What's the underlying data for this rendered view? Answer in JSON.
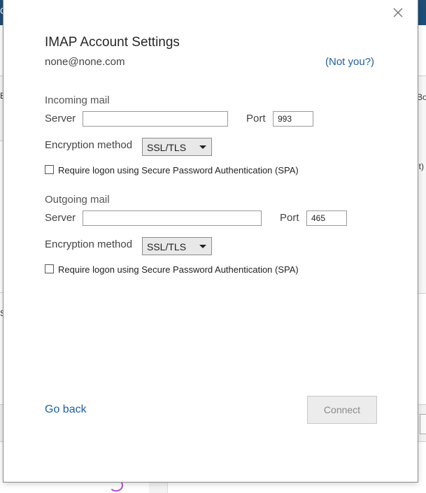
{
  "background": {
    "titlebar_letter": "O",
    "left_fragments": [
      "E",
      "S"
    ],
    "right_fragments": [
      "Bo",
      "lt)"
    ]
  },
  "dialog": {
    "title": "IMAP Account Settings",
    "email": "none@none.com",
    "not_you_link": "(Not you?)",
    "close_icon": "close-icon",
    "incoming": {
      "section_label": "Incoming mail",
      "server_label": "Server",
      "server_value": "",
      "port_label": "Port",
      "port_value": "993",
      "encryption_label": "Encryption method",
      "encryption_value": "SSL/TLS",
      "spa_label": "Require logon using Secure Password Authentication (SPA)",
      "spa_checked": false
    },
    "outgoing": {
      "section_label": "Outgoing mail",
      "server_label": "Server",
      "server_value": "",
      "port_label": "Port",
      "port_value": "465",
      "encryption_label": "Encryption method",
      "encryption_value": "SSL/TLS",
      "spa_label": "Require logon using Secure Password Authentication (SPA)",
      "spa_checked": false
    },
    "go_back_link": "Go back",
    "connect_button": "Connect",
    "connect_enabled": false
  },
  "colors": {
    "link": "#1f5fa6",
    "titlebar": "#1e4e79",
    "disabled_text": "#8a8a8a"
  }
}
